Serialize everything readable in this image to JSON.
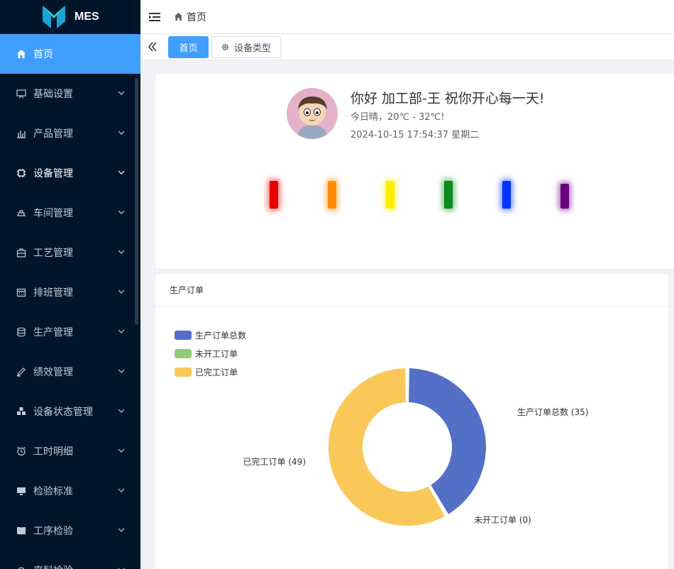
{
  "app": {
    "logo_text": "MES"
  },
  "sidebar": {
    "items": [
      {
        "label": "首页",
        "icon": "home-icon",
        "active": true
      },
      {
        "label": "基础设置",
        "icon": "monitor-board-icon"
      },
      {
        "label": "产品管理",
        "icon": "bar-chart-icon"
      },
      {
        "label": "设备管理",
        "icon": "chip-icon",
        "bright": true
      },
      {
        "label": "车间管理",
        "icon": "workshop-icon"
      },
      {
        "label": "工艺管理",
        "icon": "toolbox-icon"
      },
      {
        "label": "排班管理",
        "icon": "calendar-icon"
      },
      {
        "label": "生产管理",
        "icon": "database-icon"
      },
      {
        "label": "绩效管理",
        "icon": "pen-icon"
      },
      {
        "label": "设备状态管理",
        "icon": "cubes-icon"
      },
      {
        "label": "工时明细",
        "icon": "alarm-clock-icon"
      },
      {
        "label": "检验标准",
        "icon": "desktop-icon"
      },
      {
        "label": "工序检验",
        "icon": "book-icon"
      },
      {
        "label": "来料检验",
        "icon": "cog-icon"
      }
    ]
  },
  "topbar": {
    "breadcrumb": "首页"
  },
  "tags": {
    "active": "首页",
    "other": "设备类型"
  },
  "welcome": {
    "greeting": "你好 加工部-王 祝你开心每一天!",
    "weather": "今日晴，20℃ - 32℃!",
    "datetime": "2024-10-15 17:54:37 星期二"
  },
  "lamps": [
    {
      "color": "#e60000"
    },
    {
      "color": "#ff8c00"
    },
    {
      "color": "#ffee00"
    },
    {
      "color": "#0b8a1e"
    },
    {
      "color": "#0033ff"
    },
    {
      "color": "#6a0080"
    }
  ],
  "orders_card": {
    "title": "生产订单"
  },
  "chart_data": {
    "type": "pie",
    "title": "",
    "categories": [
      "生产订单总数",
      "未开工订单",
      "已完工订单"
    ],
    "values": [
      35,
      0,
      49
    ],
    "colors": [
      "#5470c6",
      "#91cc75",
      "#fac858"
    ],
    "labels": [
      "生产订单总数 (35)",
      "未开工订单 (0)",
      "已完工订单 (49)"
    ],
    "legend": "top-left",
    "donut": true
  }
}
